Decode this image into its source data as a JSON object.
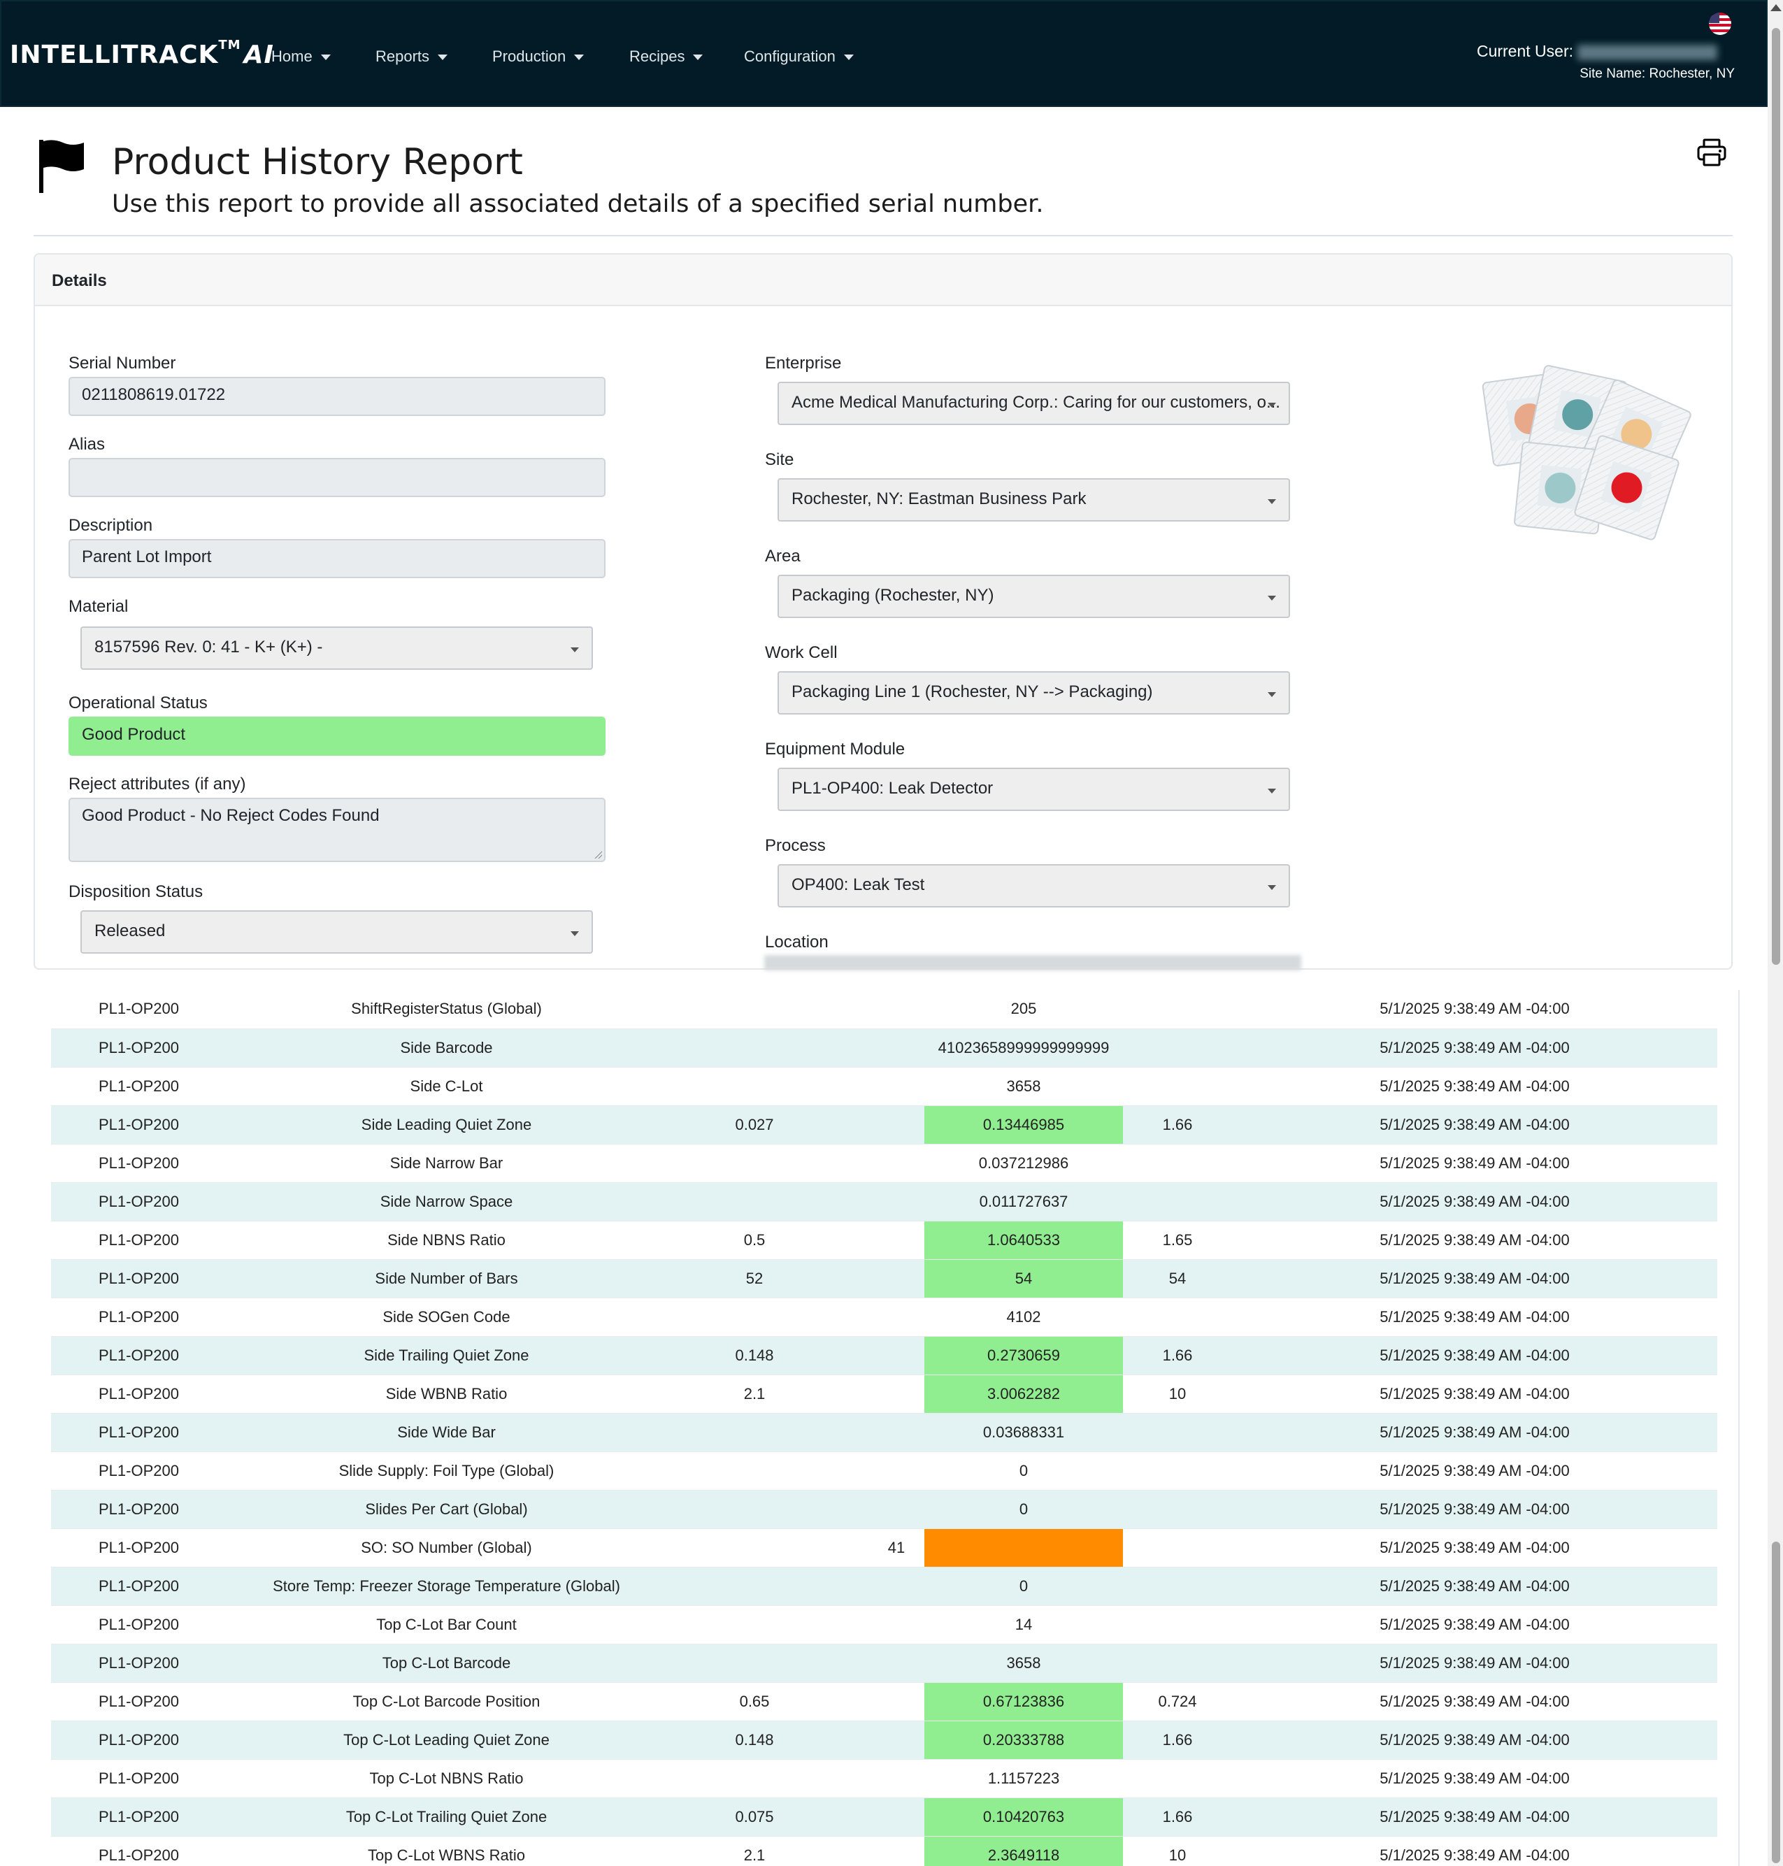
{
  "nav": {
    "brand": "INTELLITRACK",
    "brand_tm": "TM",
    "brand_ai": "AI",
    "menu": [
      "Home",
      "Reports",
      "Production",
      "Recipes",
      "Configuration"
    ],
    "current_user_label": "Current User:",
    "site_name": "Site Name: Rochester, NY"
  },
  "page": {
    "title": "Product History Report",
    "subtitle": "Use this report to provide all associated details of a specified serial number."
  },
  "details": {
    "header": "Details",
    "left": {
      "serial_label": "Serial Number",
      "serial_value": "0211808619.01722",
      "alias_label": "Alias",
      "alias_value": "",
      "description_label": "Description",
      "description_value": "Parent Lot Import",
      "material_label": "Material",
      "material_value": "8157596 Rev. 0: 41 - K+ (K+) -",
      "op_status_label": "Operational Status",
      "op_status_value": "Good Product",
      "reject_label": "Reject attributes (if any)",
      "reject_value": "Good Product - No Reject Codes Found",
      "disposition_label": "Disposition Status",
      "disposition_value": "Released"
    },
    "right": {
      "enterprise_label": "Enterprise",
      "enterprise_value": "Acme Medical Manufacturing Corp.: Caring for our customers, o...",
      "site_label": "Site",
      "site_value": "Rochester, NY: Eastman Business Park",
      "area_label": "Area",
      "area_value": "Packaging (Rochester, NY)",
      "workcell_label": "Work Cell",
      "workcell_value": "Packaging Line 1 (Rochester, NY --> Packaging)",
      "equipment_label": "Equipment Module",
      "equipment_value": "PL1-OP400: Leak Detector",
      "process_label": "Process",
      "process_value": "OP400: Leak Test",
      "location_label": "Location"
    },
    "colors": {
      "good": "#90ee90",
      "out_of_range": "#ff8c00",
      "stripe": "#e3f2f2",
      "navbar": "#021b26"
    }
  },
  "table": {
    "rows": [
      {
        "module": "PL1-OP200",
        "param": "ShiftRegisterStatus (Global)",
        "low": "",
        "value": "205",
        "high": "",
        "time": "5/1/2025 9:38:49 AM -04:00",
        "status": "none"
      },
      {
        "module": "PL1-OP200",
        "param": "Side Barcode",
        "low": "",
        "value": "41023658999999999999",
        "high": "",
        "time": "5/1/2025 9:38:49 AM -04:00",
        "status": "none"
      },
      {
        "module": "PL1-OP200",
        "param": "Side C-Lot",
        "low": "",
        "value": "3658",
        "high": "",
        "time": "5/1/2025 9:38:49 AM -04:00",
        "status": "none"
      },
      {
        "module": "PL1-OP200",
        "param": "Side Leading Quiet Zone",
        "low": "0.027",
        "value": "0.13446985",
        "high": "1.66",
        "time": "5/1/2025 9:38:49 AM -04:00",
        "status": "good"
      },
      {
        "module": "PL1-OP200",
        "param": "Side Narrow Bar",
        "low": "",
        "value": "0.037212986",
        "high": "",
        "time": "5/1/2025 9:38:49 AM -04:00",
        "status": "none"
      },
      {
        "module": "PL1-OP200",
        "param": "Side Narrow Space",
        "low": "",
        "value": "0.011727637",
        "high": "",
        "time": "5/1/2025 9:38:49 AM -04:00",
        "status": "none"
      },
      {
        "module": "PL1-OP200",
        "param": "Side NBNS Ratio",
        "low": "0.5",
        "value": "1.0640533",
        "high": "1.65",
        "time": "5/1/2025 9:38:49 AM -04:00",
        "status": "good"
      },
      {
        "module": "PL1-OP200",
        "param": "Side Number of Bars",
        "low": "52",
        "value": "54",
        "high": "54",
        "time": "5/1/2025 9:38:49 AM -04:00",
        "status": "good"
      },
      {
        "module": "PL1-OP200",
        "param": "Side SOGen Code",
        "low": "",
        "value": "4102",
        "high": "",
        "time": "5/1/2025 9:38:49 AM -04:00",
        "status": "none"
      },
      {
        "module": "PL1-OP200",
        "param": "Side Trailing Quiet Zone",
        "low": "0.148",
        "value": "0.2730659",
        "high": "1.66",
        "time": "5/1/2025 9:38:49 AM -04:00",
        "status": "good"
      },
      {
        "module": "PL1-OP200",
        "param": "Side WBNB Ratio",
        "low": "2.1",
        "value": "3.0062282",
        "high": "10",
        "time": "5/1/2025 9:38:49 AM -04:00",
        "status": "good"
      },
      {
        "module": "PL1-OP200",
        "param": "Side Wide Bar",
        "low": "",
        "value": "0.03688331",
        "high": "",
        "time": "5/1/2025 9:38:49 AM -04:00",
        "status": "none"
      },
      {
        "module": "PL1-OP200",
        "param": "Slide Supply: Foil Type (Global)",
        "low": "",
        "value": "0",
        "high": "",
        "time": "5/1/2025 9:38:49 AM -04:00",
        "status": "none"
      },
      {
        "module": "PL1-OP200",
        "param": "Slides Per Cart (Global)",
        "low": "",
        "value": "0",
        "high": "",
        "time": "5/1/2025 9:38:49 AM -04:00",
        "status": "none"
      },
      {
        "module": "PL1-OP200",
        "param": "SO: SO Number (Global)",
        "low": "41",
        "value": "",
        "high": "",
        "time": "5/1/2025 9:38:49 AM -04:00",
        "status": "bad"
      },
      {
        "module": "PL1-OP200",
        "param": "Store Temp: Freezer Storage Temperature (Global)",
        "low": "",
        "value": "0",
        "high": "",
        "time": "5/1/2025 9:38:49 AM -04:00",
        "status": "none"
      },
      {
        "module": "PL1-OP200",
        "param": "Top C-Lot Bar Count",
        "low": "",
        "value": "14",
        "high": "",
        "time": "5/1/2025 9:38:49 AM -04:00",
        "status": "none"
      },
      {
        "module": "PL1-OP200",
        "param": "Top C-Lot Barcode",
        "low": "",
        "value": "3658",
        "high": "",
        "time": "5/1/2025 9:38:49 AM -04:00",
        "status": "none"
      },
      {
        "module": "PL1-OP200",
        "param": "Top C-Lot Barcode Position",
        "low": "0.65",
        "value": "0.67123836",
        "high": "0.724",
        "time": "5/1/2025 9:38:49 AM -04:00",
        "status": "good"
      },
      {
        "module": "PL1-OP200",
        "param": "Top C-Lot Leading Quiet Zone",
        "low": "0.148",
        "value": "0.20333788",
        "high": "1.66",
        "time": "5/1/2025 9:38:49 AM -04:00",
        "status": "good"
      },
      {
        "module": "PL1-OP200",
        "param": "Top C-Lot NBNS Ratio",
        "low": "",
        "value": "1.1157223",
        "high": "",
        "time": "5/1/2025 9:38:49 AM -04:00",
        "status": "none"
      },
      {
        "module": "PL1-OP200",
        "param": "Top C-Lot Trailing Quiet Zone",
        "low": "0.075",
        "value": "0.10420763",
        "high": "1.66",
        "time": "5/1/2025 9:38:49 AM -04:00",
        "status": "good"
      },
      {
        "module": "PL1-OP200",
        "param": "Top C-Lot WBNS Ratio",
        "low": "2.1",
        "value": "2.3649118",
        "high": "10",
        "time": "5/1/2025 9:38:49 AM -04:00",
        "status": "good"
      }
    ]
  }
}
